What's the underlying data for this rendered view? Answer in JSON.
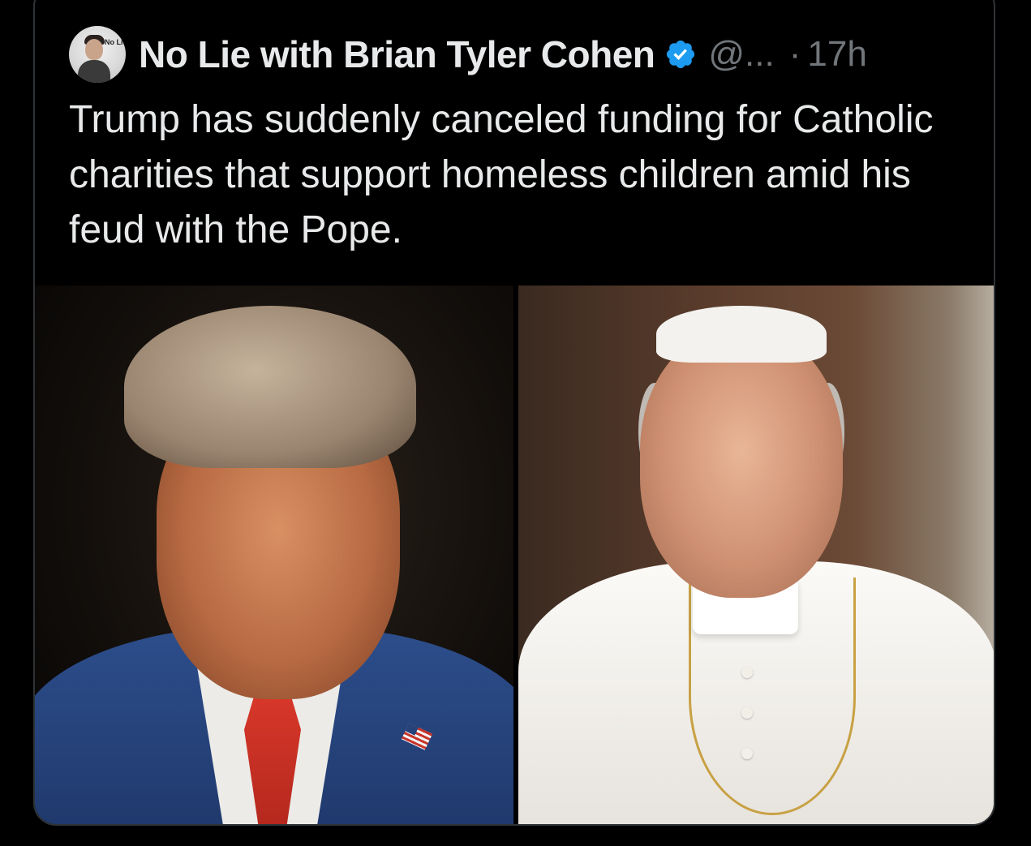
{
  "post": {
    "author_name": "No Lie with Brian Tyler Cohen",
    "handle": "@...",
    "separator": "·",
    "time": "17h",
    "avatar_logo_text": "No Lie",
    "text": "Trump has suddenly canceled funding for Catholic charities that support homeless children amid his feud with the Pope."
  },
  "icons": {
    "verified": "verified-badge-icon"
  },
  "colors": {
    "background": "#000000",
    "text": "#e7e9ea",
    "secondary_text": "#71767b",
    "verified_blue": "#1d9bf0",
    "border": "#2f3336"
  }
}
